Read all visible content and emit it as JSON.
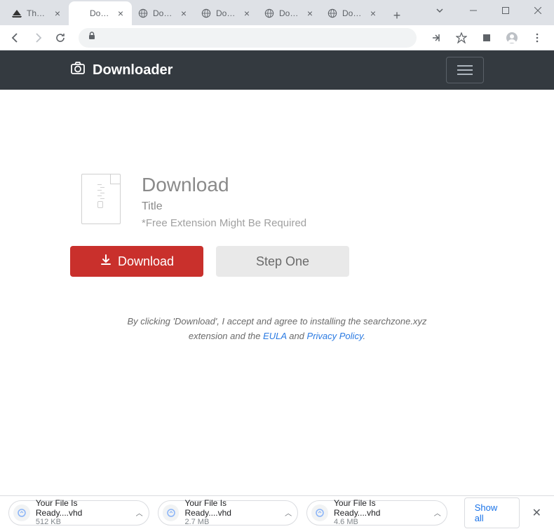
{
  "browser": {
    "tabs": [
      {
        "title": "The Pira",
        "active": false,
        "favicon": "ship"
      },
      {
        "title": "Downlo",
        "active": true,
        "favicon": "blank"
      },
      {
        "title": "Downlo",
        "active": false,
        "favicon": "globe"
      },
      {
        "title": "Downlo",
        "active": false,
        "favicon": "globe"
      },
      {
        "title": "Downlo",
        "active": false,
        "favicon": "globe"
      },
      {
        "title": "Downlo",
        "active": false,
        "favicon": "globe"
      }
    ]
  },
  "header": {
    "brand": "Downloader"
  },
  "main": {
    "heading": "Download",
    "title_label": "Title",
    "note": "*Free Extension Might Be Required",
    "download_label": "Download",
    "step_label": "Step One"
  },
  "disclaimer": {
    "line1_prefix": "By clicking 'Download', I accept and agree to installing the searchzone.xyz",
    "line2_prefix": "extension and the ",
    "eula": "EULA",
    "and": " and ",
    "privacy": "Privacy Policy",
    "period": "."
  },
  "downloads": {
    "items": [
      {
        "name": "Your File Is Ready....vhd",
        "size": "512 KB"
      },
      {
        "name": "Your File Is Ready....vhd",
        "size": "2.7 MB"
      },
      {
        "name": "Your File Is Ready....vhd",
        "size": "4.6 MB"
      }
    ],
    "show_all": "Show all"
  }
}
